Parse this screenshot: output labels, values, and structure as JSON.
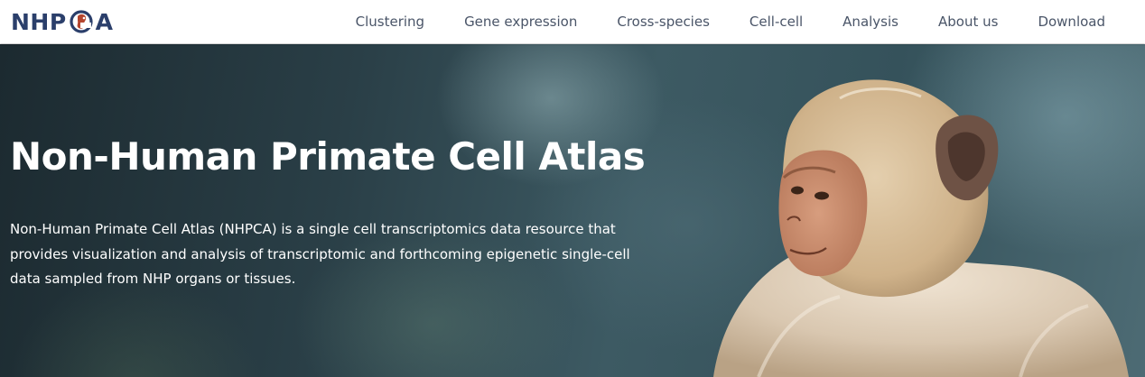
{
  "navbar": {
    "logo": {
      "text_before": "NHP",
      "text_after": "A",
      "colors": {
        "text": "#2b3f6b",
        "mark_accent": "#b4452e"
      }
    },
    "links": [
      {
        "label": "Clustering"
      },
      {
        "label": "Gene expression"
      },
      {
        "label": "Cross-species"
      },
      {
        "label": "Cell-cell"
      },
      {
        "label": "Analysis"
      },
      {
        "label": "About us"
      },
      {
        "label": "Download"
      }
    ]
  },
  "hero": {
    "title": "Non-Human Primate Cell Atlas",
    "description": "Non-Human Primate Cell Atlas (NHPCA) is a single cell transcriptomics data resource that provides visualization and analysis of transcriptomic and forthcoming epigenetic single-cell data sampled from NHP organs or tissues.",
    "image": "macaque-photo"
  }
}
